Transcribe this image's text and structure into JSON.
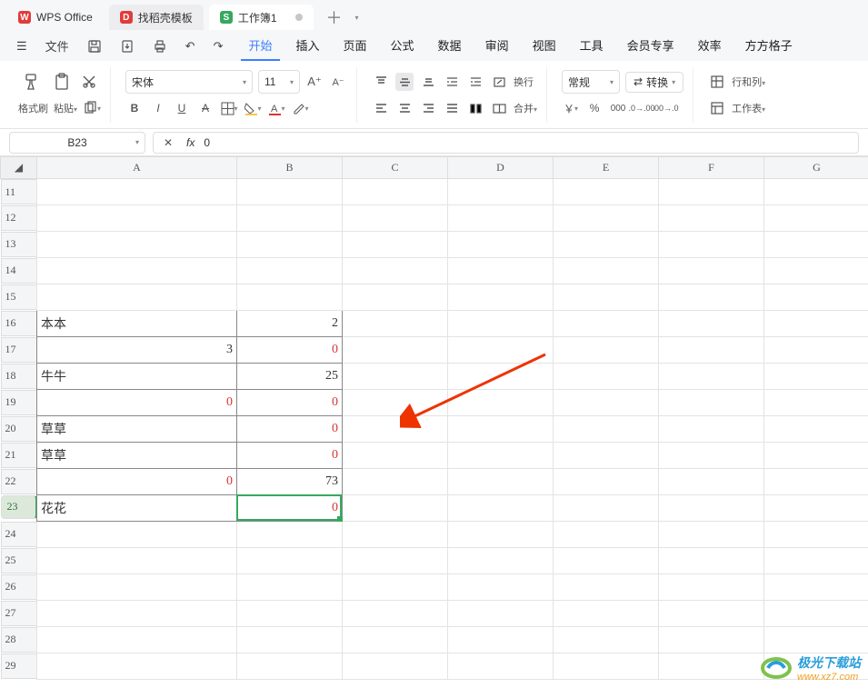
{
  "tabs": {
    "app": "WPS Office",
    "tpl": "找稻壳模板",
    "doc": "工作簿1"
  },
  "menubar": {
    "file": "文件",
    "items": [
      "开始",
      "插入",
      "页面",
      "公式",
      "数据",
      "审阅",
      "视图",
      "工具",
      "会员专享",
      "效率",
      "方方格子"
    ],
    "active": 0
  },
  "ribbon": {
    "format_painter": "格式刷",
    "paste": "粘贴",
    "font": "宋体",
    "size": "11",
    "wrap": "换行",
    "merge": "合并",
    "numfmt": "常规",
    "convert": "转换",
    "rowcol": "行和列",
    "sheet": "工作表",
    "currency": "￥"
  },
  "namebox": "B23",
  "formula": "0",
  "columns": [
    "A",
    "B",
    "C",
    "D",
    "E",
    "F",
    "G"
  ],
  "row_start": 11,
  "row_end": 29,
  "selected_row": 23,
  "cells": {
    "A16": {
      "v": "本本",
      "b": true
    },
    "B16": {
      "v": "2",
      "b": true,
      "r": true
    },
    "A17": {
      "v": "3",
      "b": true,
      "r": true
    },
    "B17": {
      "v": "0",
      "b": true,
      "r": true,
      "red": true
    },
    "A18": {
      "v": "牛牛",
      "b": true
    },
    "B18": {
      "v": "25",
      "b": true,
      "r": true
    },
    "A19": {
      "v": "0",
      "b": true,
      "r": true,
      "red": true
    },
    "B19": {
      "v": "0",
      "b": true,
      "r": true,
      "red": true
    },
    "A20": {
      "v": "草草",
      "b": true
    },
    "B20": {
      "v": "0",
      "b": true,
      "r": true,
      "red": true
    },
    "A21": {
      "v": "草草",
      "b": true
    },
    "B21": {
      "v": "0",
      "b": true,
      "r": true,
      "red": true
    },
    "A22": {
      "v": "0",
      "b": true,
      "r": true,
      "red": true
    },
    "B22": {
      "v": "73",
      "b": true,
      "r": true
    },
    "A23": {
      "v": "花花",
      "b": true
    },
    "B23": {
      "v": "0",
      "b": true,
      "r": true,
      "red": true
    }
  },
  "watermark": {
    "name": "极光下载站",
    "url": "www.xz7.com"
  }
}
